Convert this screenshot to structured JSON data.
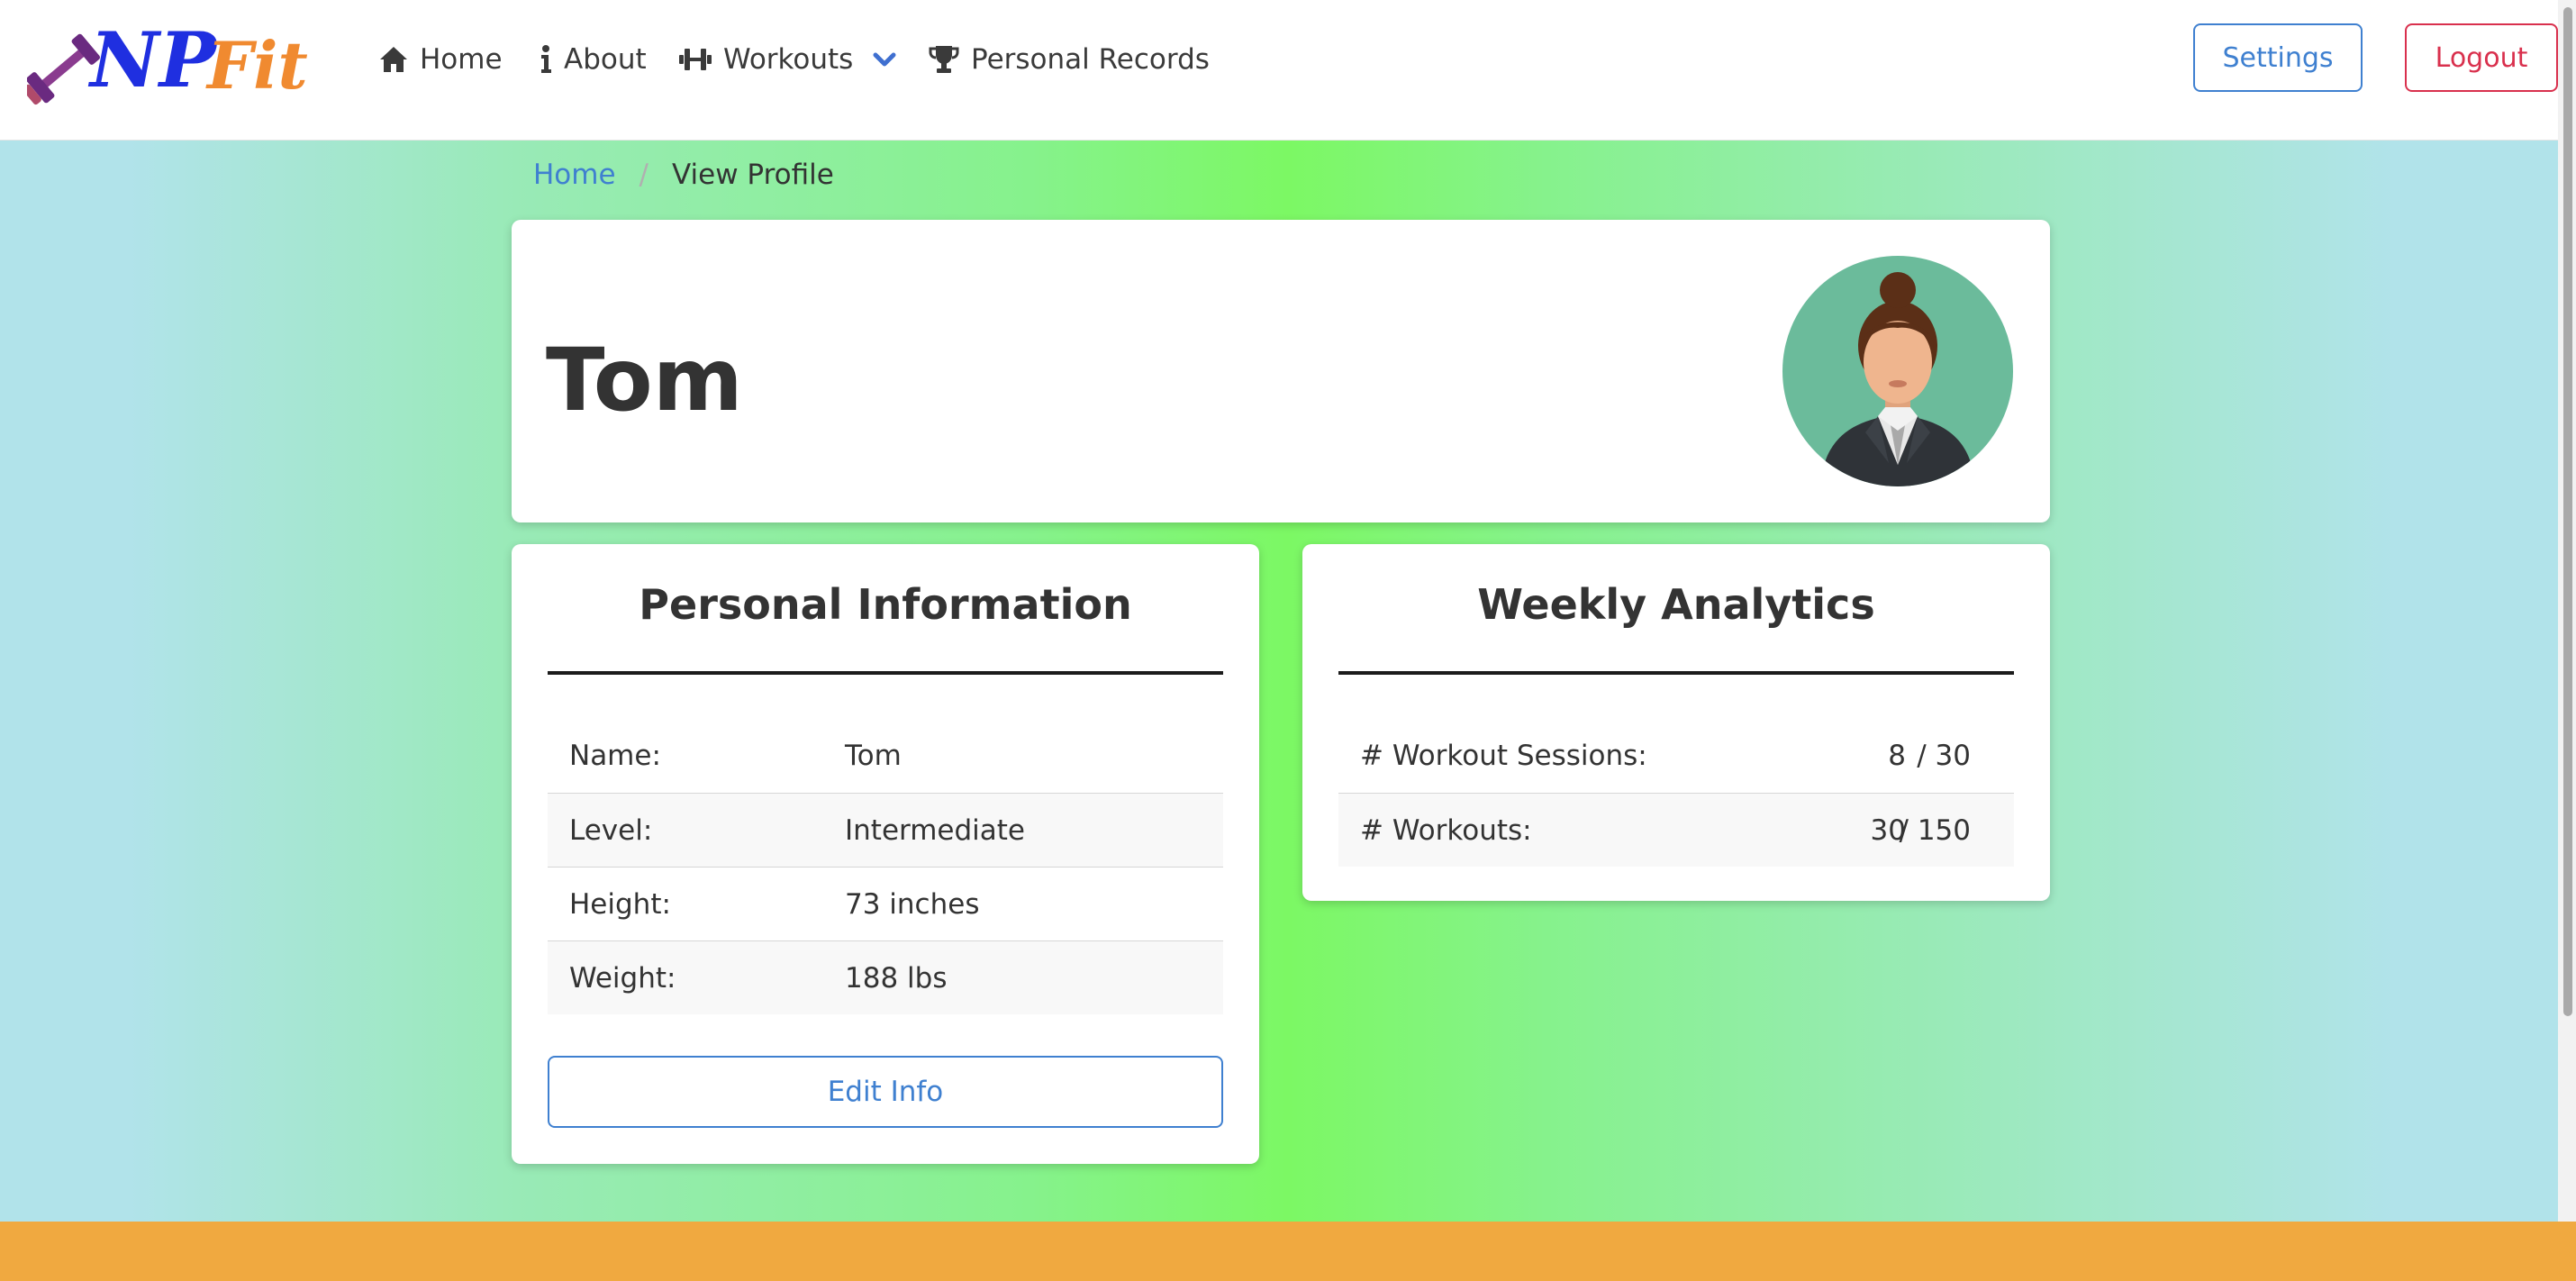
{
  "brand": {
    "logo_text": "NPFit"
  },
  "nav": {
    "home": "Home",
    "about": "About",
    "workouts": "Workouts",
    "records": "Personal Records"
  },
  "actions": {
    "settings": "Settings",
    "logout": "Logout"
  },
  "breadcrumb": {
    "home": "Home",
    "separator": "/",
    "current": "View Profile"
  },
  "profile": {
    "name": "Tom"
  },
  "personal_info": {
    "title": "Personal Information",
    "rows": [
      {
        "label": "Name:",
        "value": "Tom"
      },
      {
        "label": "Level:",
        "value": "Intermediate"
      },
      {
        "label": "Height:",
        "value": "73 inches"
      },
      {
        "label": "Weight:",
        "value": "188 lbs"
      }
    ],
    "edit_button": "Edit Info"
  },
  "analytics": {
    "title": "Weekly Analytics",
    "rows": [
      {
        "label": "# Workout Sessions:",
        "value": "8",
        "total": "/ 30"
      },
      {
        "label": "# Workouts:",
        "value": "30",
        "total": "/ 150"
      }
    ]
  },
  "colors": {
    "primary": "#3f80d0",
    "danger": "#d9304d",
    "footer": "#f0a940",
    "gradient_center": "#7cf864",
    "gradient_edge": "#b1e3ea"
  },
  "icons": {
    "home": "home-icon",
    "about": "info-icon",
    "workouts": "dumbbell-icon",
    "workouts_dropdown": "chevron-down-icon",
    "records": "trophy-icon"
  }
}
